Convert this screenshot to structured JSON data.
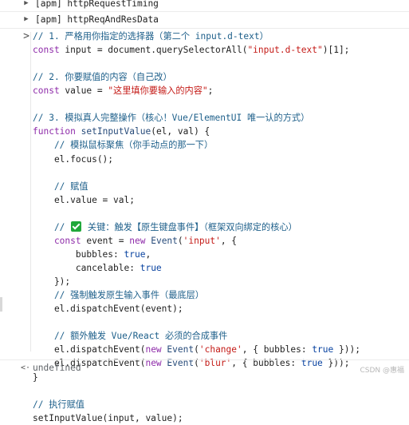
{
  "console": {
    "groups": [
      "[apm] httpRequestTiming",
      "[apm] httpReqAndResData"
    ],
    "input_prompt": ">",
    "result_prompt": "<·",
    "result_value": "undefined"
  },
  "colors": {
    "keyword": "#8e2ba9",
    "string": "#c41a16",
    "comment": "#1d5f8a",
    "number_bool": "#0842a0",
    "background": "#ffffff"
  },
  "icons": {
    "group_toggle": "triangle-right-icon",
    "input_prompt": "chevron-right-icon",
    "result_prompt": "return-arrow-icon",
    "checkmark": "green-check-icon"
  },
  "code": [
    [
      [
        "c",
        "// 1. 严格用你指定的选择器（第二个 input.d-text）"
      ]
    ],
    [
      [
        "k",
        "const"
      ],
      [
        "p",
        " input = document.querySelectorAll("
      ],
      [
        "s",
        "\"input.d-text\""
      ],
      [
        "p",
        ")[1];"
      ]
    ],
    [],
    [
      [
        "c",
        "// 2. 你要赋值的内容（自己改）"
      ]
    ],
    [
      [
        "k",
        "const"
      ],
      [
        "p",
        " value = "
      ],
      [
        "s",
        "\"这里填你要输入的内容\""
      ],
      [
        "p",
        ";"
      ]
    ],
    [],
    [
      [
        "c",
        "// 3. 模拟真人完整操作（核心！Vue/ElementUI 唯一认的方式）"
      ]
    ],
    [
      [
        "k",
        "function"
      ],
      [
        "p",
        " "
      ],
      [
        "f",
        "setInputValue"
      ],
      [
        "p",
        "(el, val) {"
      ]
    ],
    [
      [
        "c",
        "    // 模拟鼠标聚焦（你手动点的那一下）"
      ]
    ],
    [
      [
        "p",
        "    el.focus();"
      ]
    ],
    [],
    [
      [
        "c",
        "    // 赋值"
      ]
    ],
    [
      [
        "p",
        "    el.value = val;"
      ]
    ],
    [],
    [
      [
        "c",
        "    // "
      ],
      [
        "check",
        ""
      ],
      [
        "c",
        " 关键：触发【原生键盘事件】（框架双向绑定的核心）"
      ]
    ],
    [
      [
        "k",
        "    const"
      ],
      [
        "p",
        " event = "
      ],
      [
        "k",
        "new"
      ],
      [
        "p",
        " "
      ],
      [
        "f",
        "Event"
      ],
      [
        "p",
        "("
      ],
      [
        "s",
        "'input'"
      ],
      [
        "p",
        ", {"
      ]
    ],
    [
      [
        "p",
        "        bubbles: "
      ],
      [
        "b",
        "true"
      ],
      [
        "p",
        ","
      ]
    ],
    [
      [
        "p",
        "        cancelable: "
      ],
      [
        "b",
        "true"
      ]
    ],
    [
      [
        "p",
        "    });"
      ]
    ],
    [
      [
        "c",
        "    // 强制触发原生输入事件（最底层）"
      ]
    ],
    [
      [
        "p",
        "    el.dispatchEvent(event);"
      ]
    ],
    [],
    [
      [
        "c",
        "    // 额外触发 Vue/React 必须的合成事件"
      ]
    ],
    [
      [
        "p",
        "    el.dispatchEvent("
      ],
      [
        "k",
        "new"
      ],
      [
        "p",
        " "
      ],
      [
        "f",
        "Event"
      ],
      [
        "p",
        "("
      ],
      [
        "s",
        "'change'"
      ],
      [
        "p",
        ", { bubbles: "
      ],
      [
        "b",
        "true"
      ],
      [
        "p",
        " }));"
      ]
    ],
    [
      [
        "p",
        "    el.dispatchEvent("
      ],
      [
        "k",
        "new"
      ],
      [
        "p",
        " "
      ],
      [
        "f",
        "Event"
      ],
      [
        "p",
        "("
      ],
      [
        "s",
        "'blur'"
      ],
      [
        "p",
        ", { bubbles: "
      ],
      [
        "b",
        "true"
      ],
      [
        "p",
        " }));"
      ]
    ],
    [
      [
        "p",
        "}"
      ]
    ],
    [],
    [
      [
        "c",
        "// 执行赋值"
      ]
    ],
    [
      [
        "p",
        "setInputValue(input, value);"
      ]
    ]
  ],
  "watermark": "CSDN @惠福"
}
